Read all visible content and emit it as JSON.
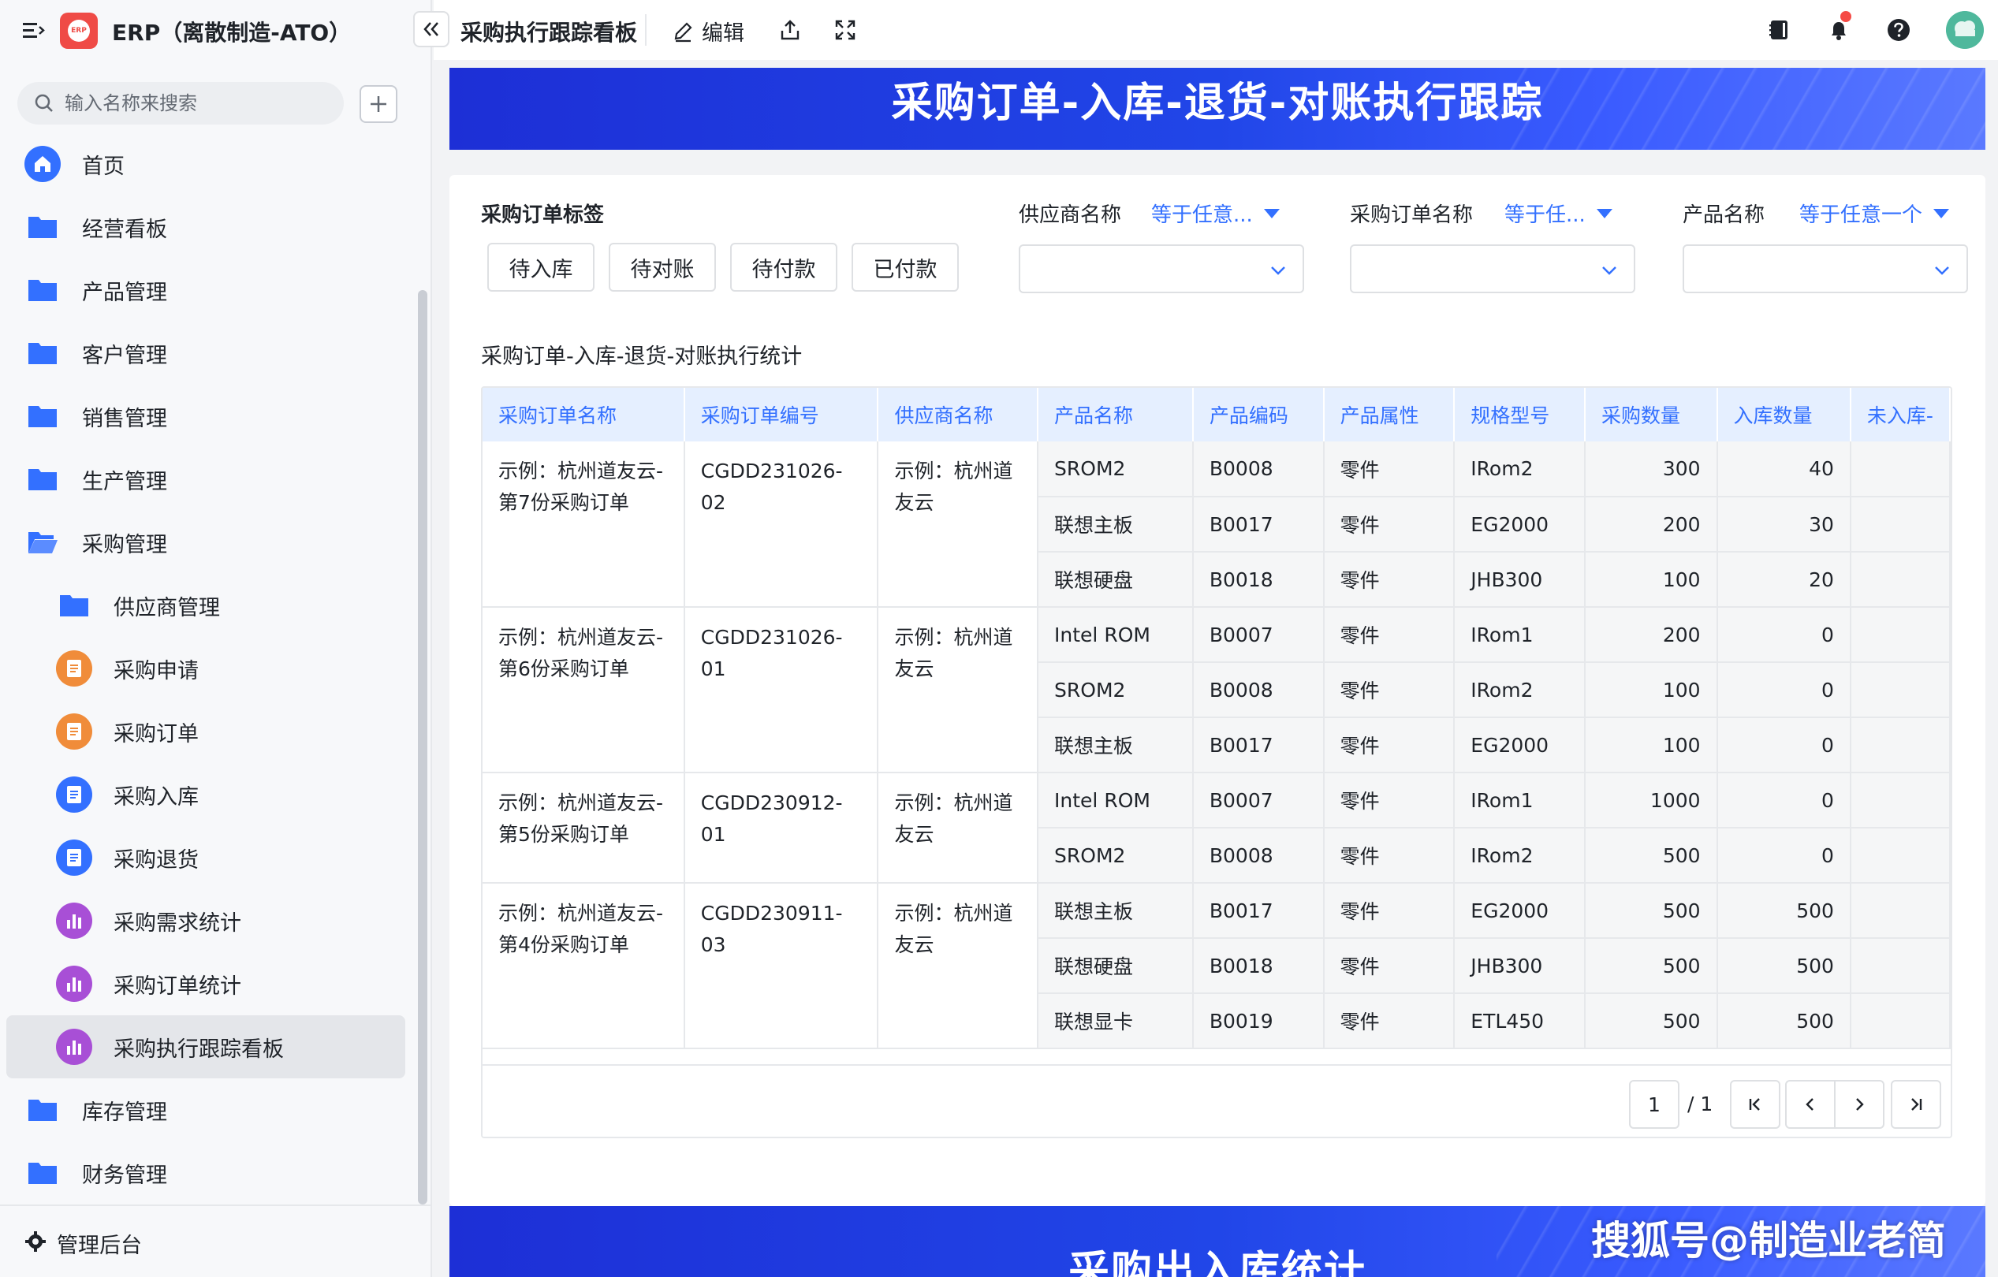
{
  "app": {
    "title": "ERP（离散制造-ATO）",
    "logo_text": "ERP"
  },
  "search": {
    "placeholder": "输入名称来搜索"
  },
  "sidebar": {
    "items": [
      {
        "label": "首页",
        "icon": "home-icon"
      },
      {
        "label": "经营看板",
        "icon": "folder-icon"
      },
      {
        "label": "产品管理",
        "icon": "folder-icon"
      },
      {
        "label": "客户管理",
        "icon": "folder-icon"
      },
      {
        "label": "销售管理",
        "icon": "folder-icon"
      },
      {
        "label": "生产管理",
        "icon": "folder-icon"
      },
      {
        "label": "采购管理",
        "icon": "folder-open-icon"
      },
      {
        "label": "供应商管理",
        "icon": "folder-icon"
      },
      {
        "label": "采购申请",
        "icon": "form-icon"
      },
      {
        "label": "采购订单",
        "icon": "form-icon"
      },
      {
        "label": "采购入库",
        "icon": "form-icon"
      },
      {
        "label": "采购退货",
        "icon": "form-icon"
      },
      {
        "label": "采购需求统计",
        "icon": "chart-icon"
      },
      {
        "label": "采购订单统计",
        "icon": "chart-icon"
      },
      {
        "label": "采购执行跟踪看板",
        "icon": "chart-icon"
      },
      {
        "label": "库存管理",
        "icon": "folder-icon"
      },
      {
        "label": "财务管理",
        "icon": "folder-icon"
      }
    ],
    "footer_label": "管理后台"
  },
  "topbar": {
    "page_title": "采购执行跟踪看板",
    "edit_label": "编辑"
  },
  "main": {
    "banner_title": "采购订单-入库-退货-对账执行跟踪",
    "filters": {
      "tag_label": "采购订单标签",
      "tags": [
        "待入库",
        "待对账",
        "待付款",
        "已付款"
      ],
      "supplier_label": "供应商名称",
      "supplier_op": "等于任意...",
      "order_label": "采购订单名称",
      "order_op": "等于任...",
      "product_label": "产品名称",
      "product_op": "等于任意一个"
    },
    "stat_title": "采购订单-入库-退货-对账执行统计",
    "table": {
      "columns": [
        "采购订单名称",
        "采购订单编号",
        "供应商名称",
        "产品名称",
        "产品编码",
        "产品属性",
        "规格型号",
        "采购数量",
        "入库数量",
        "未入库-"
      ],
      "groups": [
        {
          "order_name": "示例：杭州道友云-第7份采购订单",
          "order_no": "CGDD231026-02",
          "supplier": "示例：杭州道友云",
          "rows": [
            {
              "product": "SROM2",
              "code": "B0008",
              "attr": "零件",
              "spec": "IRom2",
              "qty": "300",
              "in": "40"
            },
            {
              "product": "联想主板",
              "code": "B0017",
              "attr": "零件",
              "spec": "EG2000",
              "qty": "200",
              "in": "30"
            },
            {
              "product": "联想硬盘",
              "code": "B0018",
              "attr": "零件",
              "spec": "JHB300",
              "qty": "100",
              "in": "20"
            }
          ]
        },
        {
          "order_name": "示例：杭州道友云-第6份采购订单",
          "order_no": "CGDD231026-01",
          "supplier": "示例：杭州道友云",
          "rows": [
            {
              "product": "Intel ROM",
              "code": "B0007",
              "attr": "零件",
              "spec": "IRom1",
              "qty": "200",
              "in": "0"
            },
            {
              "product": "SROM2",
              "code": "B0008",
              "attr": "零件",
              "spec": "IRom2",
              "qty": "100",
              "in": "0"
            },
            {
              "product": "联想主板",
              "code": "B0017",
              "attr": "零件",
              "spec": "EG2000",
              "qty": "100",
              "in": "0"
            }
          ]
        },
        {
          "order_name": "示例：杭州道友云-第5份采购订单",
          "order_no": "CGDD230912-01",
          "supplier": "示例：杭州道友云",
          "rows": [
            {
              "product": "Intel ROM",
              "code": "B0007",
              "attr": "零件",
              "spec": "IRom1",
              "qty": "1000",
              "in": "0"
            },
            {
              "product": "SROM2",
              "code": "B0008",
              "attr": "零件",
              "spec": "IRom2",
              "qty": "500",
              "in": "0"
            }
          ]
        },
        {
          "order_name": "示例：杭州道友云-第4份采购订单",
          "order_no": "CGDD230911-03",
          "supplier": "示例：杭州道友云",
          "rows": [
            {
              "product": "联想主板",
              "code": "B0017",
              "attr": "零件",
              "spec": "EG2000",
              "qty": "500",
              "in": "500"
            },
            {
              "product": "联想硬盘",
              "code": "B0018",
              "attr": "零件",
              "spec": "JHB300",
              "qty": "500",
              "in": "500"
            },
            {
              "product": "联想显卡",
              "code": "B0019",
              "attr": "零件",
              "spec": "ETL450",
              "qty": "500",
              "in": "500"
            }
          ]
        }
      ]
    },
    "pagination": {
      "current": "1",
      "total": "/ 1"
    },
    "banner2_title": "采购出入库统计"
  },
  "watermark": "搜狐号@制造业老简",
  "colors": {
    "accent": "#3370ff",
    "banner": "#2146e8",
    "logo": "#ef4b46"
  }
}
